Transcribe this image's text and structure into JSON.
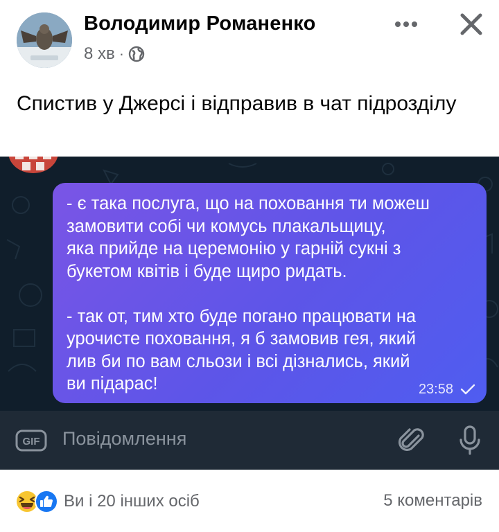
{
  "post": {
    "author_name": "Володимир Романенко",
    "time": "8 хв",
    "separator": "·",
    "privacy_icon": "globe-icon",
    "text": "Спистив у Джерсі і відправив в чат підрозділу"
  },
  "shared_image": {
    "message": "- є така послуга, що на поховання ти можеш\nзамовити собі чи комусь плакальщицу,\nяка прийде на церемонію у гарній сукні з\nбукетом квітів і буде щиро ридать.\n\n- так от, тим хто буде погано працювати на\nурочисте поховання, я б замовив гея, який\nлив би по вам сльози і всі дізнались, який\nви підарас!",
    "time": "23:58",
    "input_placeholder": "Повідомлення",
    "gif_label": "GIF",
    "bubble_color_start": "#7a55e6",
    "bubble_color_end": "#4f5df0"
  },
  "footer": {
    "reactions_text": "Ви і 20 інших осіб",
    "comments_text": "5 коментарів",
    "reaction_icons": [
      "haha-icon",
      "like-icon"
    ]
  }
}
